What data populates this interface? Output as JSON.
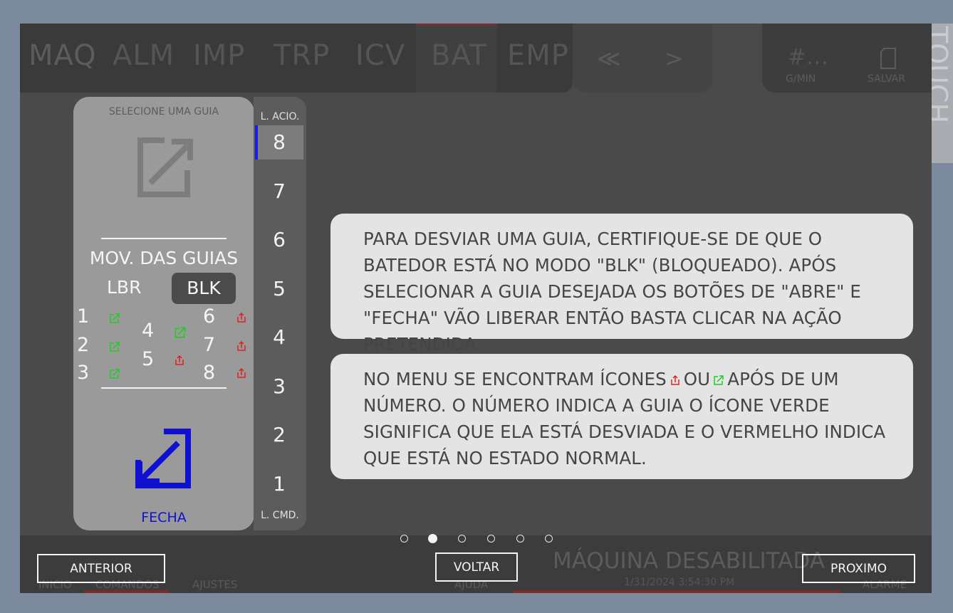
{
  "top_nav": {
    "tabs": [
      "MAQ",
      "ALM",
      "IMP",
      "TRP",
      "ICV",
      "BAT",
      "EMP"
    ],
    "prev_arrow": "≪",
    "next_arrow": ">",
    "counter_value": "#...",
    "counter_unit": "G/MIN",
    "save_label": "SALVAR",
    "side_tab_label": "TOUCH"
  },
  "menu_panel": {
    "title": "SELECIONE UMA GUIA",
    "section_title": "MOV. DAS GUIAS",
    "mode_lbr": "LBR",
    "mode_blk": "BLK",
    "guides": [
      {
        "num": "1",
        "state": "green"
      },
      {
        "num": "2",
        "state": "green"
      },
      {
        "num": "3",
        "state": "green"
      },
      {
        "num": "4",
        "state": "green"
      },
      {
        "num": "5",
        "state": "red"
      },
      {
        "num": "6",
        "state": "red"
      },
      {
        "num": "7",
        "state": "red"
      },
      {
        "num": "8",
        "state": "red"
      }
    ],
    "action_label": "FECHA"
  },
  "levels": {
    "top_label": "L. ACIO.",
    "bottom_label": "L. CMD.",
    "values": [
      "8",
      "7",
      "6",
      "5",
      "4",
      "3",
      "2",
      "1"
    ],
    "active": "8"
  },
  "help": {
    "box1": "PARA DESVIAR UMA GUIA, CERTIFIQUE-SE DE QUE O BATEDOR ESTÁ NO MODO \"BLK\" (BLOQUEADO). APÓS SELECIONAR A GUIA DESEJADA OS BOTÕES DE \"ABRE\" E \"FECHA\" VÃO LIBERAR ENTÃO BASTA CLICAR NA AÇÃO PRETENDIDA.",
    "box2_part1": "NO MENU SE ENCONTRAM ÍCONES",
    "box2_or": "OU",
    "box2_part2": "APÓS DE UM NÚMERO. O NÚMERO INDICA A GUIA O ÍCONE VERDE SIGNIFICA QUE ELA ESTÁ DESVIADA E O VERMELHO INDICA QUE ESTÁ NO ESTADO NORMAL."
  },
  "pager": {
    "total": 6,
    "current": 2
  },
  "bottom_nav": {
    "items": [
      "INICIO",
      "COMANDOS",
      "AJUSTES",
      "AJUDA",
      "ALARME"
    ],
    "status_title": "MÁQUINA DESABILITADA",
    "status_sub": "1/31/2024 3:54:30 PM"
  },
  "buttons": {
    "previous": "ANTERIOR",
    "back": "VOLTAR",
    "next": "PROXIMO"
  },
  "colors": {
    "green_icon": "#22cc22",
    "red_icon": "#e02020",
    "fecha_blue": "#1010d0",
    "active_level_bar": "#1a1af0"
  }
}
